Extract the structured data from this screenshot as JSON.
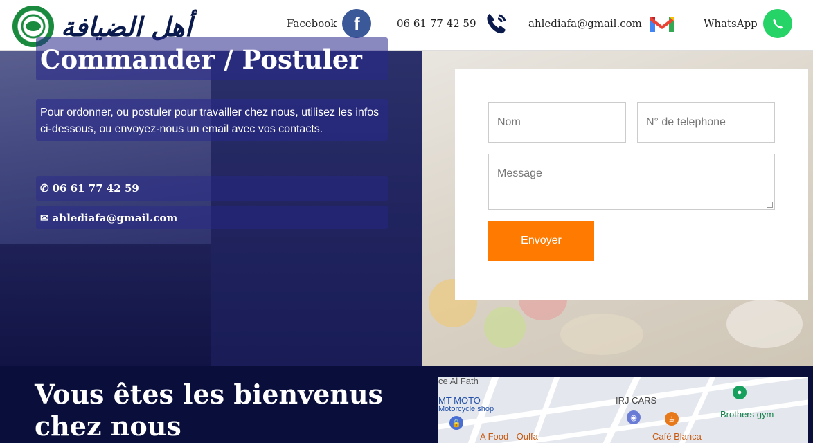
{
  "header": {
    "logo_text": "أهل الضيافة",
    "facebook_label": "Facebook",
    "phone_label": "06 61 77 42 59",
    "email_label": "ahlediafa@gmail.com",
    "whatsapp_label": "WhatsApp"
  },
  "hero": {
    "title": "Commander / Postuler",
    "description": "Pour ordonner, ou postuler pour travailler chez nous, utilisez les infos ci-dessous, ou envoyez-nous un email avec vos contacts.",
    "phone": "06 61 77 42 59",
    "email": "ahlediafa@gmail.com"
  },
  "form": {
    "name_placeholder": "Nom",
    "phone_placeholder": "N° de telephone",
    "message_placeholder": "Message",
    "submit_label": "Envoyer"
  },
  "welcome": {
    "heading_line1": "Vous êtes les bienvenus",
    "heading_line2": "chez nous"
  },
  "map": {
    "labels": [
      "ce Al Fath",
      "MT MOTO",
      "Motorcycle shop",
      "IRJ CARS",
      "Brothers gym",
      "A Food - Oulfa",
      "Café Blanca"
    ]
  },
  "colors": {
    "accent": "#ff7a00",
    "navy": "#0a0e3a",
    "facebook": "#3b5998",
    "whatsapp": "#25d366"
  }
}
